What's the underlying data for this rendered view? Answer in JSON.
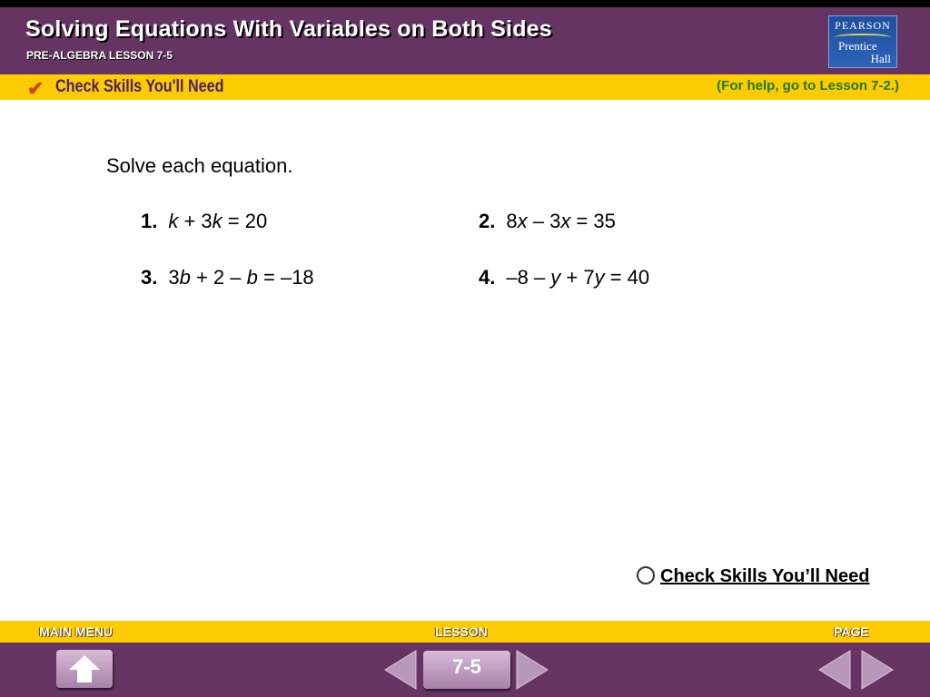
{
  "header": {
    "title": "Solving Equations With Variables on Both Sides",
    "subtitle": "PRE-ALGEBRA LESSON 7-5",
    "logo": {
      "line1": "PEARSON",
      "line2": "Prentice",
      "line3": "Hall"
    }
  },
  "banner": {
    "label": "Check Skills You'll Need",
    "help": "(For help, go to Lesson 7-2.)",
    "icon": "checkmark-icon"
  },
  "main": {
    "instruction": "Solve each equation.",
    "problems": [
      {
        "number": "1.",
        "segments": [
          {
            "t": "k",
            "i": true
          },
          {
            "t": " + 3"
          },
          {
            "t": "k",
            "i": true
          },
          {
            "t": " = 20"
          }
        ]
      },
      {
        "number": "2.",
        "segments": [
          {
            "t": "8"
          },
          {
            "t": "x",
            "i": true
          },
          {
            "t": " – 3"
          },
          {
            "t": "x",
            "i": true
          },
          {
            "t": " = 35"
          }
        ]
      },
      {
        "number": "3.",
        "segments": [
          {
            "t": "3"
          },
          {
            "t": "b",
            "i": true
          },
          {
            "t": " + 2 – "
          },
          {
            "t": "b",
            "i": true
          },
          {
            "t": " = –18"
          }
        ]
      },
      {
        "number": "4.",
        "segments": [
          {
            "t": "–8 – "
          },
          {
            "t": "y",
            "i": true
          },
          {
            "t": " + 7"
          },
          {
            "t": "y",
            "i": true
          },
          {
            "t": " = 40"
          }
        ]
      }
    ],
    "link": "Check Skills You’ll Need"
  },
  "footer": {
    "main_menu": "MAIN MENU",
    "lesson": "LESSON",
    "page": "PAGE",
    "lesson_number": "7-5"
  },
  "colors": {
    "purple": "#653463",
    "yellow": "#fccb00",
    "help_green": "#1f7a1f"
  }
}
